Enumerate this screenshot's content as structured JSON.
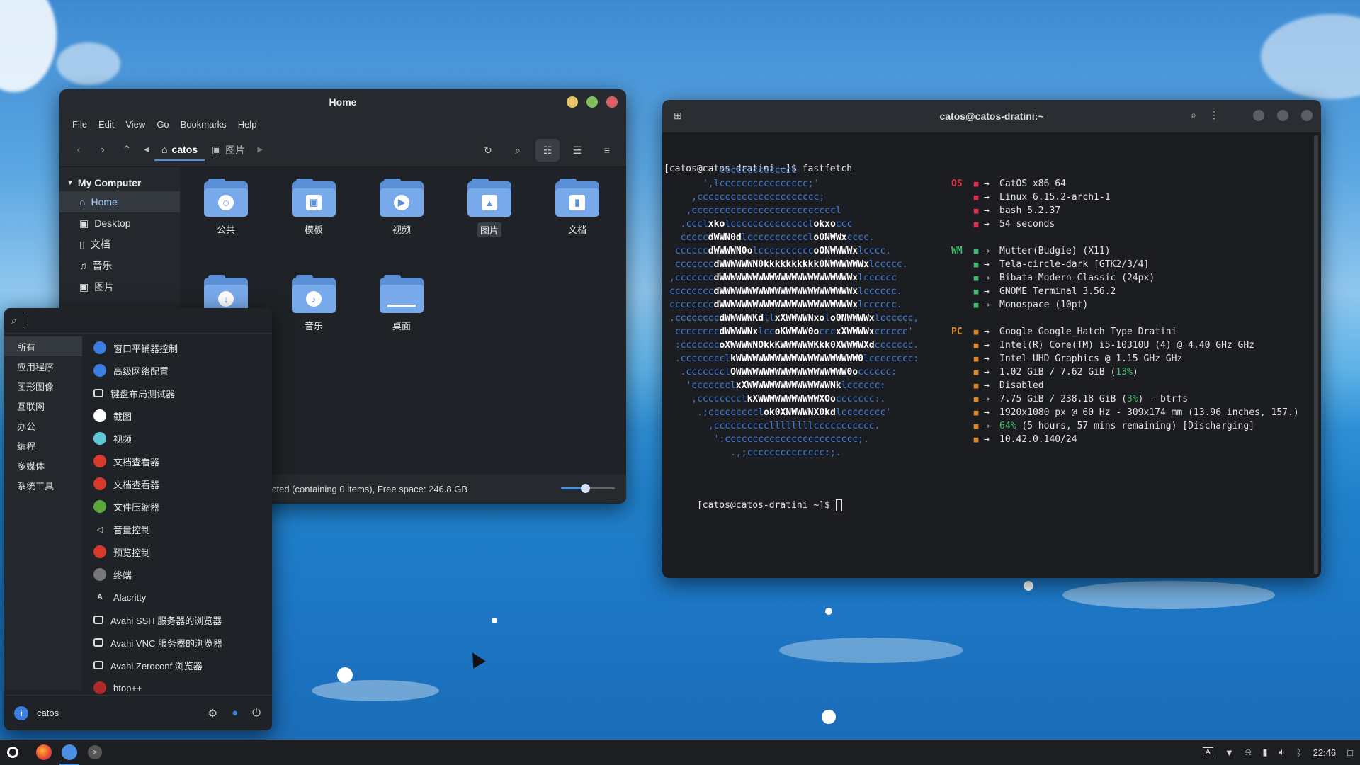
{
  "file_manager": {
    "title": "Home",
    "menu": [
      "File",
      "Edit",
      "View",
      "Go",
      "Bookmarks",
      "Help"
    ],
    "breadcrumb": {
      "current": "catos",
      "next": "图片"
    },
    "sidebar": {
      "heading": "My Computer",
      "items": [
        {
          "label": "Home",
          "icon": "home-icon"
        },
        {
          "label": "Desktop",
          "icon": "desktop-icon"
        },
        {
          "label": "文档",
          "icon": "document-icon"
        },
        {
          "label": "音乐",
          "icon": "music-icon"
        },
        {
          "label": "图片",
          "icon": "picture-icon"
        }
      ]
    },
    "files": [
      {
        "label": "公共",
        "emblem": "person"
      },
      {
        "label": "模板",
        "emblem": "template"
      },
      {
        "label": "视频",
        "emblem": "play"
      },
      {
        "label": "图片",
        "emblem": "image"
      },
      {
        "label": "文档",
        "emblem": "doc"
      },
      {
        "label": "",
        "emblem": "download"
      },
      {
        "label": "音乐",
        "emblem": "music"
      },
      {
        "label": "桌面",
        "emblem": "desktop"
      }
    ],
    "status": "cted (containing 0 items), Free space: 246.8 GB",
    "zoom_level": 0.45
  },
  "terminal": {
    "title": "catos@catos-dratini:~",
    "prompt1": "[catos@catos-dratini ~]$ fastfetch",
    "prompt2": "[catos@catos-dratini ~]$ ",
    "logo_lines": [
      "         cccccccccccccc",
      "      ',lcccccccccccccccc;'",
      "    ,cccccccccccccccccccccc;",
      "   ,ccccccccccccccccccccccccccl'",
      "  .ccclxkolcccccccccccccclokxoccc",
      "  cccccdWWN0dlcccccccccccloONWWxcccc.",
      " ccccccdWWWWN0olccccccccccoONWWWWxlcccc.",
      " cccccccdWWWWWWN0kkkkkkkkkk0NWWWWWWxlccccc.",
      ",cccccccdWWWWWWWWWWWWWWWWWWWWWWWWxlcccccc",
      "ccccccccdWWWWWWWWWWWWWWWWWWWWWWWWxlcccccc.",
      "ccccccccdWWWWWWWWWWWWWWWWWWWWWWWWxlcccccc.",
      ".ccccccccdWWWWWKdllxXWWWWNxolo0NWWWWxlcccccc,",
      " ccccccccdWWWWNxlccoKWWWW0occcxXWWWWxcccccc'",
      " :cccccccoXWWWWNOkkKWWWWWWKkk0XWWWWXdccccccc.",
      " .cccccccclkWWWWWWWWWWWWWWWWWWWWWW0lcccccccc:",
      "  .ccccccclOWWWWWWWWWWWWWWWWWWWW0occcccc:",
      "   'ccccccclxXWWWWWWWWWWWWWWWNklcccccc:",
      "    ,cccccccclkXWWWWWWWWWWWXOoccccccc:.",
      "     .;ccccccccclok0XNWWWNX0kdlcccccccc'",
      "       ,ccccccccccllllllllccccccccccc.",
      "        ':cccccccccccccccccccccccc;.",
      "           .,;cccccccccccccc:;."
    ],
    "info": [
      {
        "key": "OS",
        "key_class": "k-os",
        "icon": "os-icon",
        "text": "CatOS x86_64"
      },
      {
        "key": "",
        "key_class": "k-os",
        "icon": "kernel-icon",
        "text": "Linux 6.15.2-arch1-1"
      },
      {
        "key": "",
        "key_class": "k-os",
        "icon": "shell-icon",
        "text": "bash 5.2.37"
      },
      {
        "key": "",
        "key_class": "k-os",
        "icon": "uptime-icon",
        "text": "54 seconds"
      },
      {
        "key": "",
        "key_class": "",
        "icon": "",
        "text": ""
      },
      {
        "key": "WM",
        "key_class": "k-wm",
        "icon": "wm-icon",
        "text": "Mutter(Budgie) (X11)"
      },
      {
        "key": "",
        "key_class": "k-wm",
        "icon": "theme-icon",
        "text": "Tela-circle-dark [GTK2/3/4]"
      },
      {
        "key": "",
        "key_class": "k-wm",
        "icon": "cursor-icon",
        "text": "Bibata-Modern-Classic (24px)"
      },
      {
        "key": "",
        "key_class": "k-wm",
        "icon": "terminal-icon",
        "text": "GNOME Terminal 3.56.2"
      },
      {
        "key": "",
        "key_class": "k-wm",
        "icon": "font-icon",
        "text": "Monospace (10pt)"
      },
      {
        "key": "",
        "key_class": "",
        "icon": "",
        "text": ""
      },
      {
        "key": "PC",
        "key_class": "k-pc",
        "icon": "host-icon",
        "text": "Google Google_Hatch Type Dratini"
      },
      {
        "key": "",
        "key_class": "k-pc",
        "icon": "cpu-icon",
        "text": "Intel(R) Core(TM) i5-10310U (4) @ 4.40 GHz GHz"
      },
      {
        "key": "",
        "key_class": "k-pc",
        "icon": "gpu-icon",
        "text": "Intel UHD Graphics @ 1.15 GHz GHz"
      },
      {
        "key": "",
        "key_class": "k-pc",
        "icon": "memory-icon",
        "text": "1.02 GiB / 7.62 GiB (",
        "pct": "13%",
        "tail": ")"
      },
      {
        "key": "",
        "key_class": "k-pc",
        "icon": "swap-icon",
        "text": "Disabled"
      },
      {
        "key": "",
        "key_class": "k-pc",
        "icon": "disk-icon",
        "text": "7.75 GiB / 238.18 GiB (",
        "pct": "3%",
        "tail": ") - btrfs"
      },
      {
        "key": "",
        "key_class": "k-pc",
        "icon": "display-icon",
        "text": "1920x1080 px @ 60 Hz - 309x174 mm (13.96 inches, 157.)"
      },
      {
        "key": "",
        "key_class": "k-pc",
        "icon": "battery-icon",
        "text": "",
        "pct": "64%",
        "tail": " (5 hours, 57 mins remaining) [Discharging]"
      },
      {
        "key": "",
        "key_class": "k-pc",
        "icon": "network-icon",
        "text": "10.42.0.140/24"
      }
    ]
  },
  "launcher": {
    "search_placeholder": "",
    "categories": [
      "所有",
      "应用程序",
      "图形图像",
      "互联网",
      "办公",
      "编程",
      "多媒体",
      "系统工具"
    ],
    "apps": [
      {
        "label": "窗口平铺器控制",
        "icon": "tiling-icon",
        "color": "#3b7ee0"
      },
      {
        "label": "高级网络配置",
        "icon": "network-config-icon",
        "color": "#3b7ee0"
      },
      {
        "label": "键盘布局测试器",
        "icon": "keyboard-icon",
        "color": "square"
      },
      {
        "label": "截图",
        "icon": "screenshot-icon",
        "color": "#ffffff"
      },
      {
        "label": "视频",
        "icon": "video-icon",
        "color": "#5fc7d8"
      },
      {
        "label": "文档查看器",
        "icon": "pdf-icon",
        "color": "#d9382e"
      },
      {
        "label": "文档查看器",
        "icon": "pdf-icon",
        "color": "#d9382e"
      },
      {
        "label": "文件压缩器",
        "icon": "archive-icon",
        "color": "#5aa83a"
      },
      {
        "label": "音量控制",
        "icon": "volume-icon",
        "color": "speaker"
      },
      {
        "label": "预览控制",
        "icon": "preview-icon",
        "color": "#d9382e"
      },
      {
        "label": "终端",
        "icon": "terminal-icon",
        "color": "#777777"
      },
      {
        "label": "Alacritty",
        "icon": "alacritty-icon",
        "color": "alacritty"
      },
      {
        "label": "Avahi SSH 服务器的浏览器",
        "icon": "window-icon",
        "color": "square"
      },
      {
        "label": "Avahi VNC 服务器的浏览器",
        "icon": "window-icon",
        "color": "square"
      },
      {
        "label": "Avahi Zeroconf 浏览器",
        "icon": "window-icon",
        "color": "square"
      },
      {
        "label": "btop++",
        "icon": "btop-icon",
        "color": "#b02a2a"
      }
    ],
    "user": "catos"
  },
  "taskbar": {
    "clock": "22:46"
  }
}
